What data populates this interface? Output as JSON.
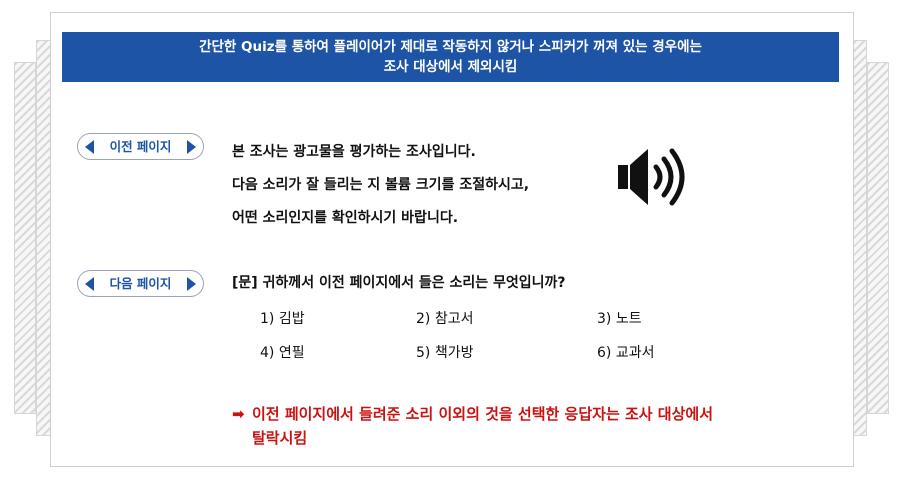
{
  "banner": {
    "line1": "간단한 Quiz를 통하여 플레이어가 제대로 작동하지 않거나 스피커가 꺼져 있는 경우에는",
    "line2": "조사 대상에서 제외시킴"
  },
  "nav": {
    "prev_label": "이전 페이지",
    "next_label": "다음 페이지"
  },
  "intro": {
    "line1": "본 조사는 광고물을 평가하는 조사입니다.",
    "line2": "다음 소리가 잘 들리는 지 볼륨 크기를 조절하시고,",
    "line3": "어떤 소리인지를 확인하시기 바랍니다."
  },
  "question": {
    "text": "[문] 귀하께서 이전 페이지에서 들은 소리는 무엇입니까?",
    "options": [
      "1) 김밥",
      "2) 참고서",
      "3) 노트",
      "4) 연필",
      "5) 책가방",
      "6) 교과서"
    ]
  },
  "warning": {
    "arrow": "➡",
    "line1": "이전 페이지에서 들려준 소리 이외의 것을 선택한  응답자는 조사 대상에서",
    "line2": "탈락시킴"
  },
  "icons": {
    "speaker": "speaker-volume-icon",
    "prev": "triangle-left-icon",
    "next": "triangle-right-icon"
  },
  "colors": {
    "banner": "#1e54a5",
    "accent": "#1e54a5",
    "warning": "#cc1111"
  }
}
